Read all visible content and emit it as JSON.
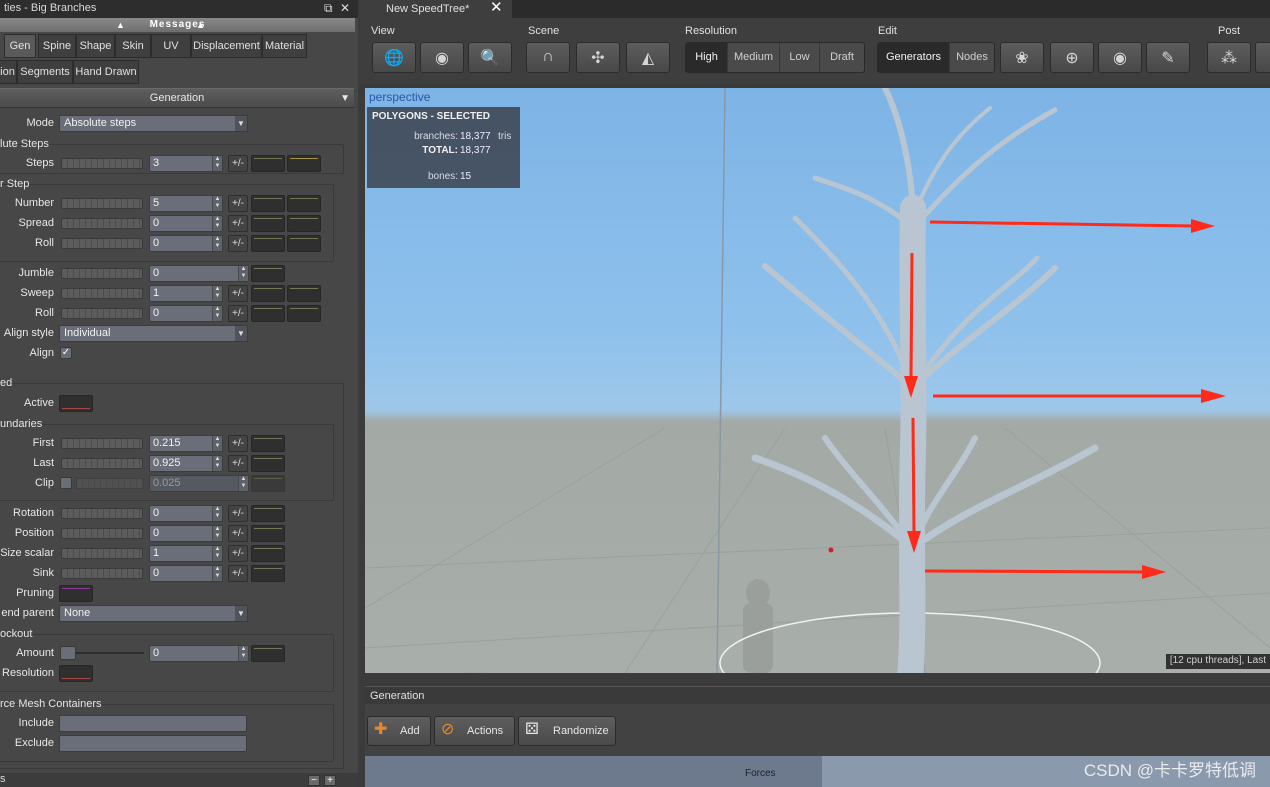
{
  "left_panel": {
    "title": "ties - Big Branches",
    "messages": "Messages",
    "tabs_row1": [
      "Gen",
      "Spine",
      "Shape",
      "Skin",
      "UV",
      "Displacement",
      "Material"
    ],
    "tabs_row2": [
      "ion",
      "Segments",
      "Hand Drawn"
    ],
    "section": "Generation",
    "mode_label": "Mode",
    "mode_value": "Absolute steps",
    "abs_steps_title": "lute Steps",
    "steps_label": "Steps",
    "steps_value": "3",
    "step_title": "r Step",
    "number_label": "Number",
    "number_value": "5",
    "spread_label": "Spread",
    "spread_value": "0",
    "roll_label": "Roll",
    "roll_value": "0",
    "jumble_label": "Jumble",
    "jumble_value": "0",
    "sweep_label": "Sweep",
    "sweep_value": "1",
    "roll2_label": "Roll",
    "roll2_value": "0",
    "align_style_label": "Align style",
    "align_style_value": "Individual",
    "align_label": "Align",
    "align_check": "✓",
    "ed_title": "ed",
    "active_label": "Active",
    "boundaries_title": "undaries",
    "first_label": "First",
    "first_value": "0.215",
    "last_label": "Last",
    "last_value": "0.925",
    "clip_label": "Clip",
    "clip_value": "0.025",
    "rotation_label": "Rotation",
    "rotation_value": "0",
    "position_label": "Position",
    "position_value": "0",
    "size_scalar_label": "Size scalar",
    "size_scalar_value": "1",
    "sink_label": "Sink",
    "sink_value": "0",
    "pruning_label": "Pruning",
    "end_parent_label": "end parent",
    "end_parent_value": "None",
    "knockout_title": "ockout",
    "amount_label": "Amount",
    "amount_value": "0",
    "resolution_label": "Resolution",
    "mesh_title": "rce Mesh Containers",
    "include_label": "Include",
    "exclude_label": "Exclude",
    "pm": "+/-",
    "bottom_letter": "s",
    "minus": "−",
    "plus": "+"
  },
  "doc_tab": {
    "title": "New SpeedTree*",
    "close": "✕"
  },
  "toolbar": {
    "view_label": "View",
    "scene_label": "Scene",
    "resolution_label": "Resolution",
    "edit_label": "Edit",
    "post_label": "Post",
    "resolution_options": [
      "High",
      "Medium",
      "Low",
      "Draft"
    ],
    "resolution_selected": "High",
    "edit_options": [
      "Generators",
      "Nodes"
    ]
  },
  "viewport": {
    "label": "perspective",
    "stats_title": "POLYGONS - SELECTED",
    "branches_key": "branches:",
    "branches_val": "18,377",
    "branches_unit": "tris",
    "total_key": "TOTAL:",
    "total_val": "18,377",
    "bones_key": "bones:",
    "bones_val": "15",
    "status": "[12 cpu threads], Last"
  },
  "generation_panel": {
    "title": "Generation",
    "add": "Add",
    "actions": "Actions",
    "randomize": "Randomize",
    "forces": "Forces"
  },
  "watermark": "CSDN @卡卡罗特低调",
  "colors": {
    "arrow": "#ff2a1a",
    "sky": "#8fc1ec",
    "ground": "#a8aea9",
    "tree": "#b9c6d1"
  }
}
